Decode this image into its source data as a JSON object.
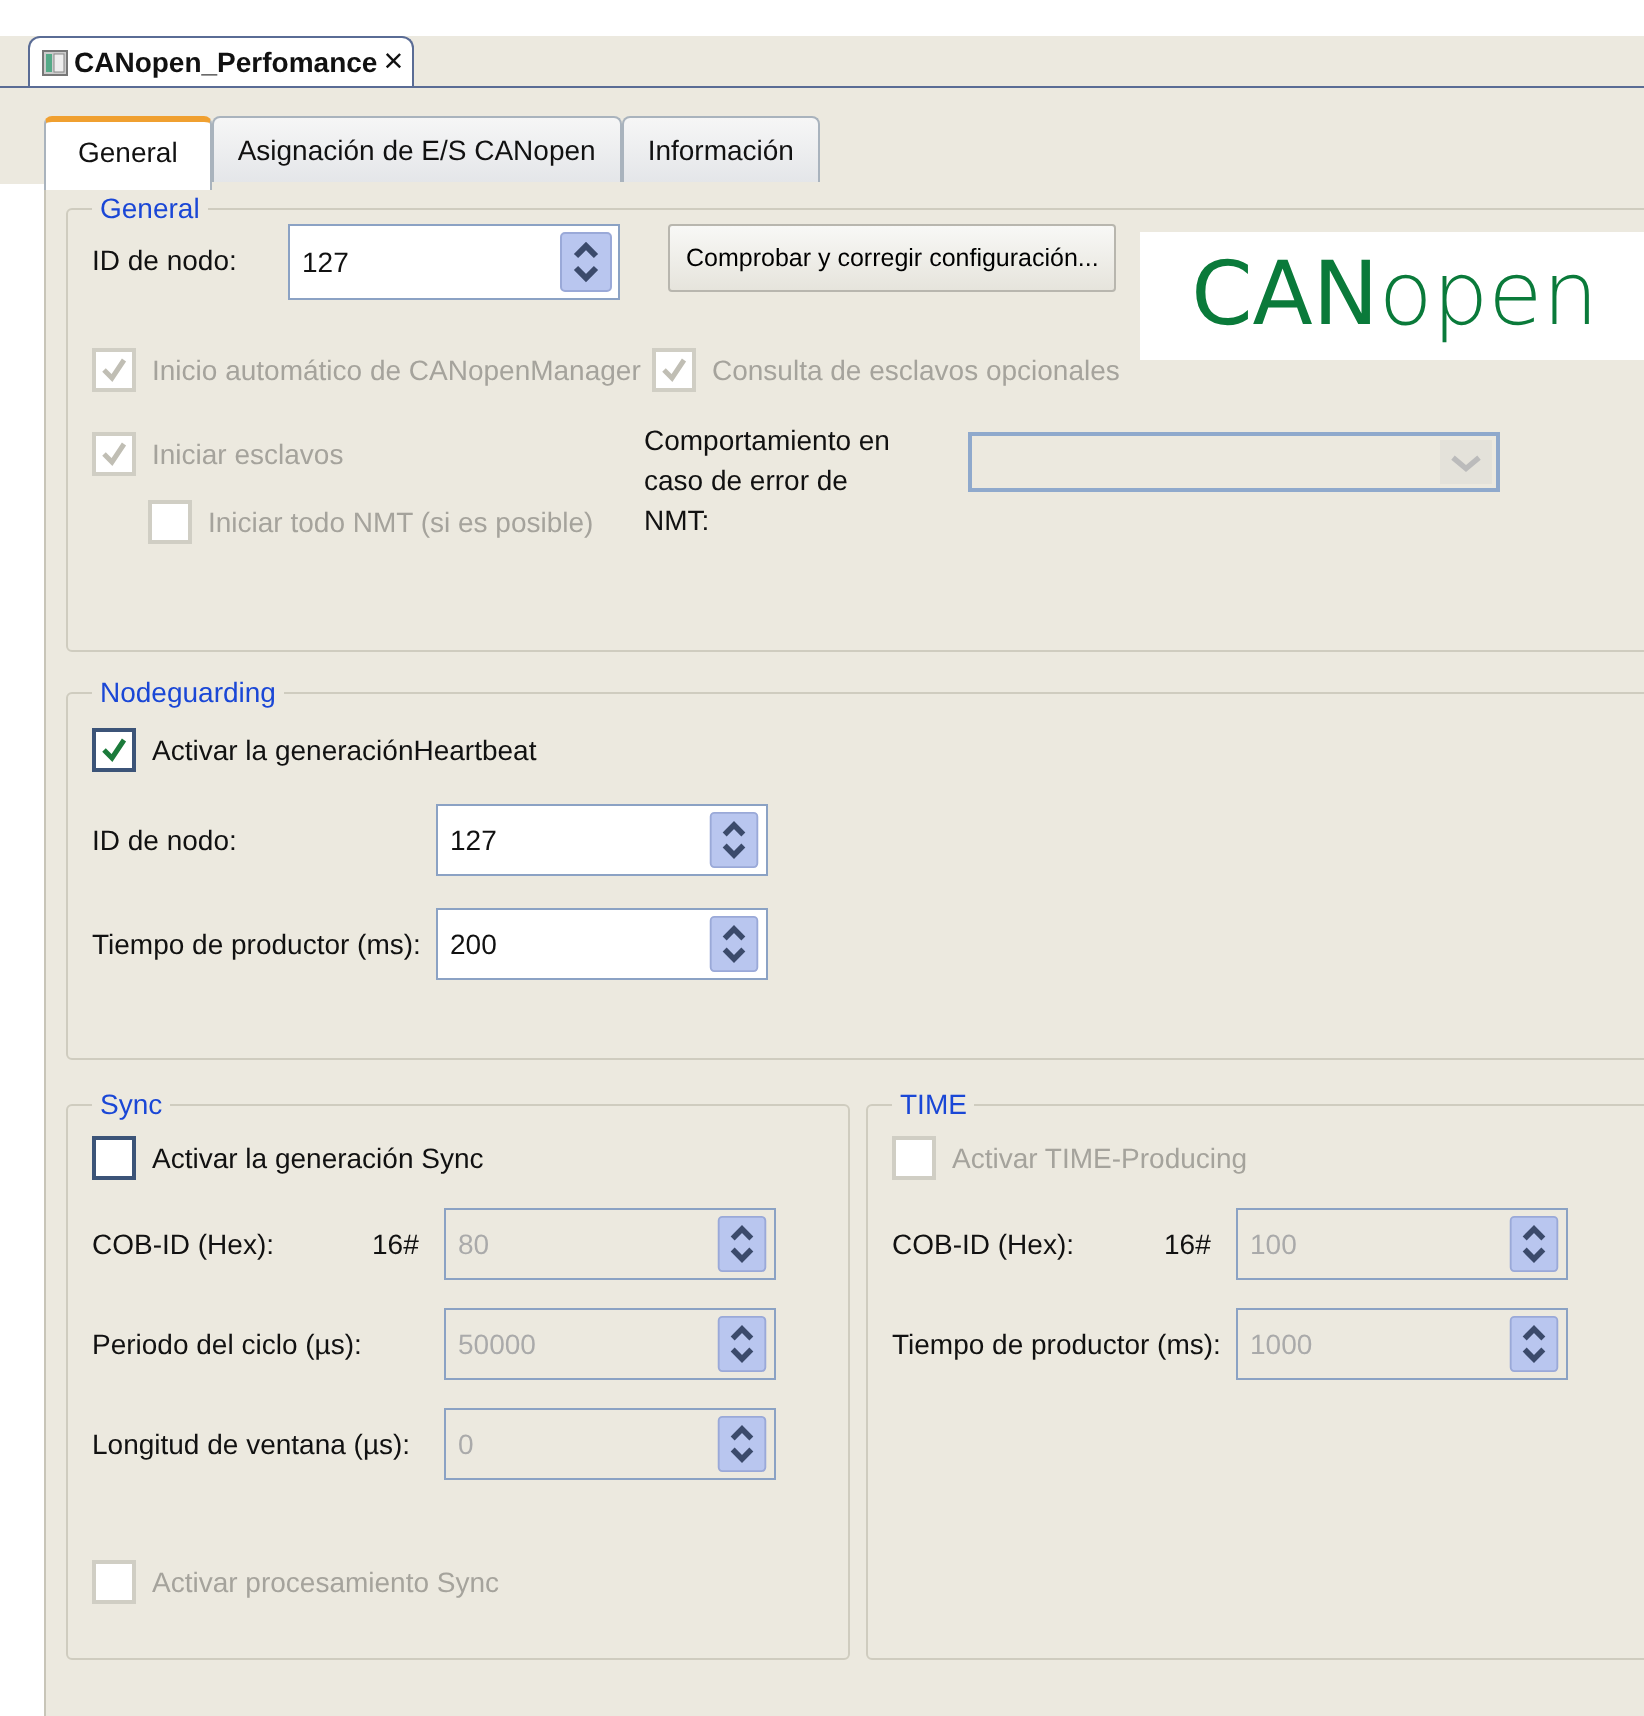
{
  "document_tab": {
    "title": "CANopen_Perfomance",
    "close": "×"
  },
  "tabs": [
    {
      "label": "General",
      "selected": true
    },
    {
      "label": "Asignación de E/S CANopen",
      "selected": false
    },
    {
      "label": "Información",
      "selected": false
    }
  ],
  "general": {
    "title": "General",
    "node_id": {
      "label": "ID de nodo:",
      "value": "127",
      "disabled": false
    },
    "check_button": "Comprobar y corregir configuración...",
    "logo": "**CAN**open",
    "autostart": {
      "label": "Inicio automático de CANopenManager",
      "checked": true,
      "disabled": true
    },
    "poll_optional": {
      "label": "Consulta de esclavos opcionales",
      "checked": true,
      "disabled": true
    },
    "start_slaves": {
      "label": "Iniciar esclavos",
      "checked": true,
      "disabled": true
    },
    "nmt_start_all": {
      "label": "Iniciar todo NMT (si es posible)",
      "checked": false,
      "disabled": true
    },
    "nmt_error": {
      "label": "Comportamiento en caso de error de NMT:",
      "disabled": true
    }
  },
  "nodeguarding": {
    "title": "Nodeguarding",
    "heartbeat": {
      "label": "Activar la generaciónHeartbeat",
      "checked": true,
      "disabled": false
    },
    "fields": [
      {
        "label": "ID de nodo:",
        "value": "127",
        "disabled": false
      },
      {
        "label": "Tiempo de productor (ms):",
        "value": "200",
        "disabled": false
      }
    ]
  },
  "sync": {
    "title": "Sync",
    "enable": {
      "label": "Activar la generación Sync",
      "checked": false,
      "disabled": false
    },
    "fields": [
      {
        "label": "COB-ID (Hex):",
        "prefix": "16#",
        "value": "80",
        "disabled": true
      },
      {
        "label": "Periodo del ciclo (µs):",
        "value": "50000",
        "disabled": true
      },
      {
        "label": "Longitud de ventana (µs):",
        "value": "0",
        "disabled": true
      }
    ],
    "processing": {
      "label": "Activar procesamiento Sync",
      "checked": false,
      "disabled": true
    }
  },
  "time": {
    "title": "TIME",
    "enable": {
      "label": "Activar TIME-Producing",
      "checked": false,
      "disabled": true
    },
    "fields": [
      {
        "label": "COB-ID (Hex):",
        "prefix": "16#",
        "value": "100",
        "disabled": true
      },
      {
        "label": "Tiempo de productor (ms):",
        "value": "1000",
        "disabled": true
      }
    ]
  }
}
